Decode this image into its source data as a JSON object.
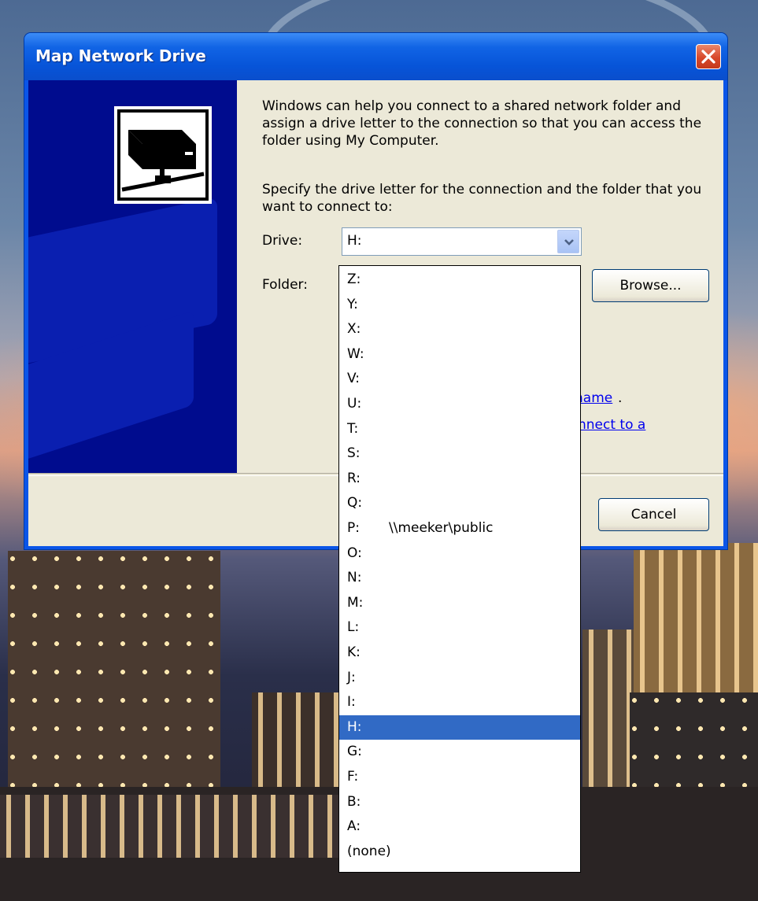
{
  "dialog": {
    "title": "Map Network Drive",
    "intro_text": "Windows can help you connect to a shared network folder and assign a drive letter to the connection so that you can access the folder using My Computer.",
    "specify_text": "Specify the drive letter for the connection and the folder that you want to connect to:",
    "drive_label": "Drive:",
    "folder_label": "Folder:",
    "drive_value": "H:",
    "browse_label": "Browse...",
    "cancel_label": "Cancel",
    "link_fragment_1": "name",
    "link_fragment_1_suffix": ".",
    "link_fragment_2": "nnect to a"
  },
  "drive_list": [
    {
      "letter": "Z:",
      "path": ""
    },
    {
      "letter": "Y:",
      "path": ""
    },
    {
      "letter": "X:",
      "path": ""
    },
    {
      "letter": "W:",
      "path": ""
    },
    {
      "letter": "V:",
      "path": ""
    },
    {
      "letter": "U:",
      "path": ""
    },
    {
      "letter": "T:",
      "path": ""
    },
    {
      "letter": "S:",
      "path": ""
    },
    {
      "letter": "R:",
      "path": ""
    },
    {
      "letter": "Q:",
      "path": ""
    },
    {
      "letter": "P:",
      "path": "\\\\meeker\\public"
    },
    {
      "letter": "O:",
      "path": ""
    },
    {
      "letter": "N:",
      "path": ""
    },
    {
      "letter": "M:",
      "path": ""
    },
    {
      "letter": "L:",
      "path": ""
    },
    {
      "letter": "K:",
      "path": ""
    },
    {
      "letter": "J:",
      "path": ""
    },
    {
      "letter": "I:",
      "path": ""
    },
    {
      "letter": "H:",
      "path": "",
      "selected": true
    },
    {
      "letter": "G:",
      "path": ""
    },
    {
      "letter": "F:",
      "path": ""
    },
    {
      "letter": "B:",
      "path": ""
    },
    {
      "letter": "A:",
      "path": ""
    },
    {
      "letter": "(none)",
      "path": ""
    }
  ],
  "colors": {
    "title_bar": "#0a55e8",
    "selection": "#316ac5",
    "dialog_face": "#ece9d8",
    "art_panel": "#000c8e"
  },
  "icons": [
    "close-icon",
    "network-drive-icon",
    "chevron-down-icon"
  ]
}
